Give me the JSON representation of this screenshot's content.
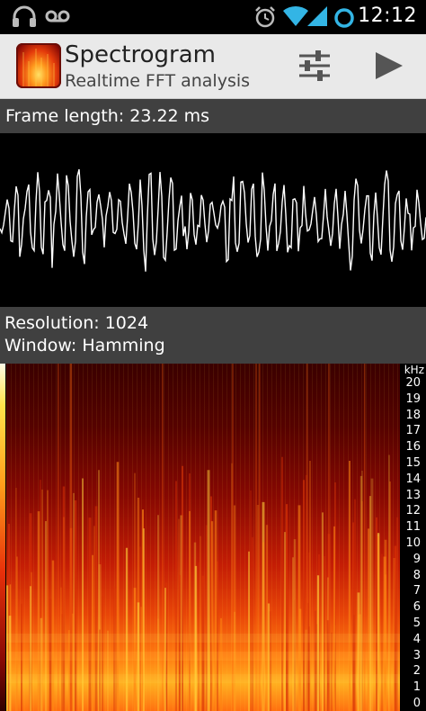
{
  "status_bar": {
    "time": "12:12",
    "icons": [
      "headphones-icon",
      "voicemail-icon",
      "alarm-icon",
      "wifi-icon",
      "signal-icon",
      "sync-icon"
    ]
  },
  "action_bar": {
    "title": "Spectrogram",
    "subtitle": "Realtime FFT analysis",
    "icons": [
      "spectrogram-app-icon",
      "settings-sliders-icon",
      "play-icon"
    ]
  },
  "frame_info": {
    "label": "Frame length: 23.22 ms"
  },
  "resolution_info": {
    "resolution": "Resolution: 1024",
    "window": "Window: Hamming"
  },
  "spectrogram": {
    "unit": "kHz",
    "ticks": [
      "20",
      "19",
      "18",
      "17",
      "16",
      "15",
      "14",
      "13",
      "12",
      "11",
      "10",
      "9",
      "8",
      "7",
      "6",
      "5",
      "4",
      "3",
      "2",
      "1",
      "0"
    ]
  },
  "colors": {
    "action_bar_bg": "#e9e9e9",
    "info_bar_bg": "#404040",
    "waveform_line": "#ffffff"
  }
}
